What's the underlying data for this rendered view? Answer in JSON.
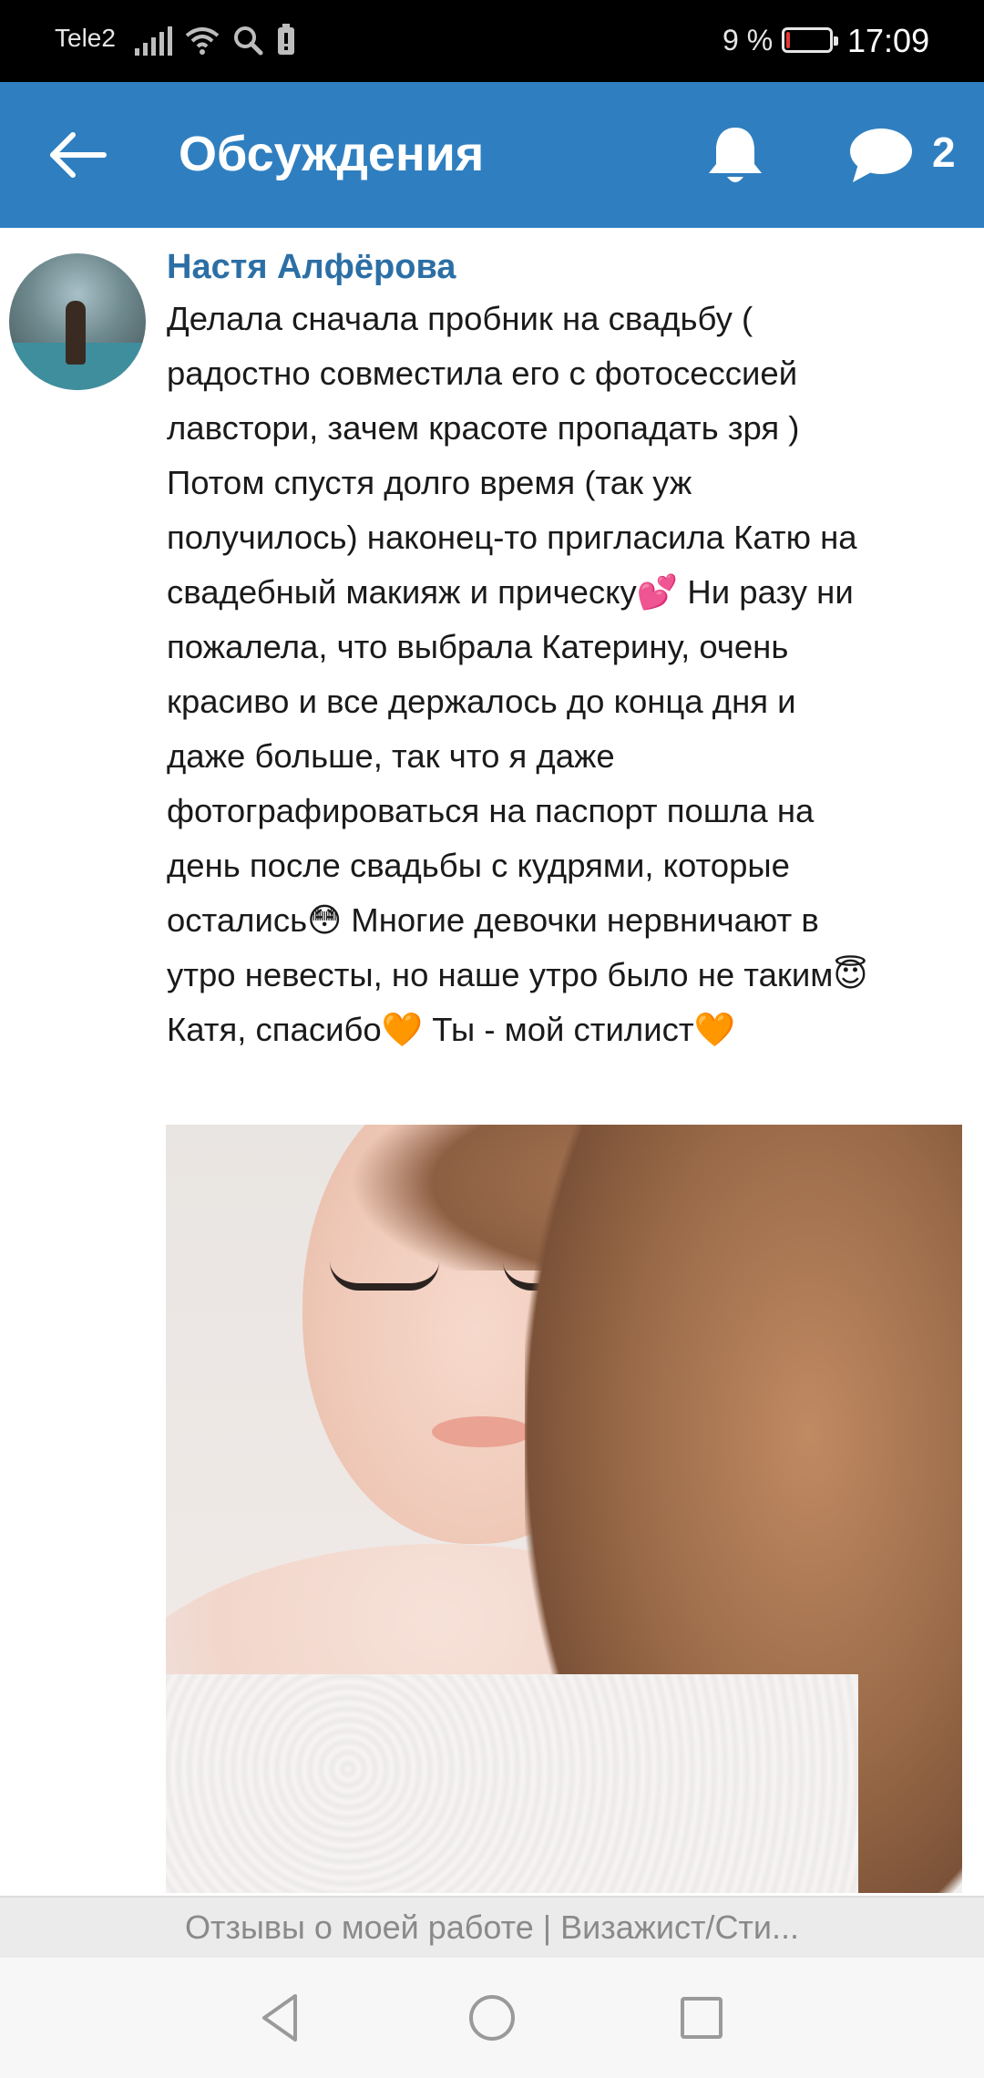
{
  "status_bar": {
    "carrier": "Tele2",
    "battery_percent": "9 %",
    "battery_level": 0.09,
    "time": "17:09",
    "icons": [
      "signal-icon",
      "wifi-icon",
      "search-icon",
      "battery-saver-icon"
    ]
  },
  "header": {
    "back_icon": "arrow-left-icon",
    "title": "Обсуждения",
    "bell_icon": "bell-icon",
    "messages_icon": "chat-bubble-icon",
    "messages_count": "2",
    "background_color": "#2f7fc0"
  },
  "post": {
    "author": "Настя Алфёрова",
    "author_color": "#2c6fa5",
    "text": "Делала сначала пробник на свадьбу (\nрадостно совместила его с фотосессией\nлавстори, зачем красоте пропадать зря )\nПотом спустя долго время (так уж\nполучилось) наконец-то пригласила Катю на\nсвадебный макияж и прическу💕 Ни разу ни\nпожалела, что выбрала Катерину, очень\nкрасиво и все держалось до конца дня и\nдаже больше, так что я даже\nфотографироваться на паспорт пошла на\nдень после свадьбы с кудрями, которые\nостались😳 Многие девочки нервничают в\nутро невесты, но наше утро было не таким😇\nКатя, спасибо🧡 Ты - мой стилист🧡"
  },
  "topic_bar": {
    "text": "Отзывы о моей работе | Визажист/Сти..."
  },
  "nav_bar": {
    "buttons": [
      "back-triangle-icon",
      "home-circle-icon",
      "recents-square-icon"
    ]
  }
}
